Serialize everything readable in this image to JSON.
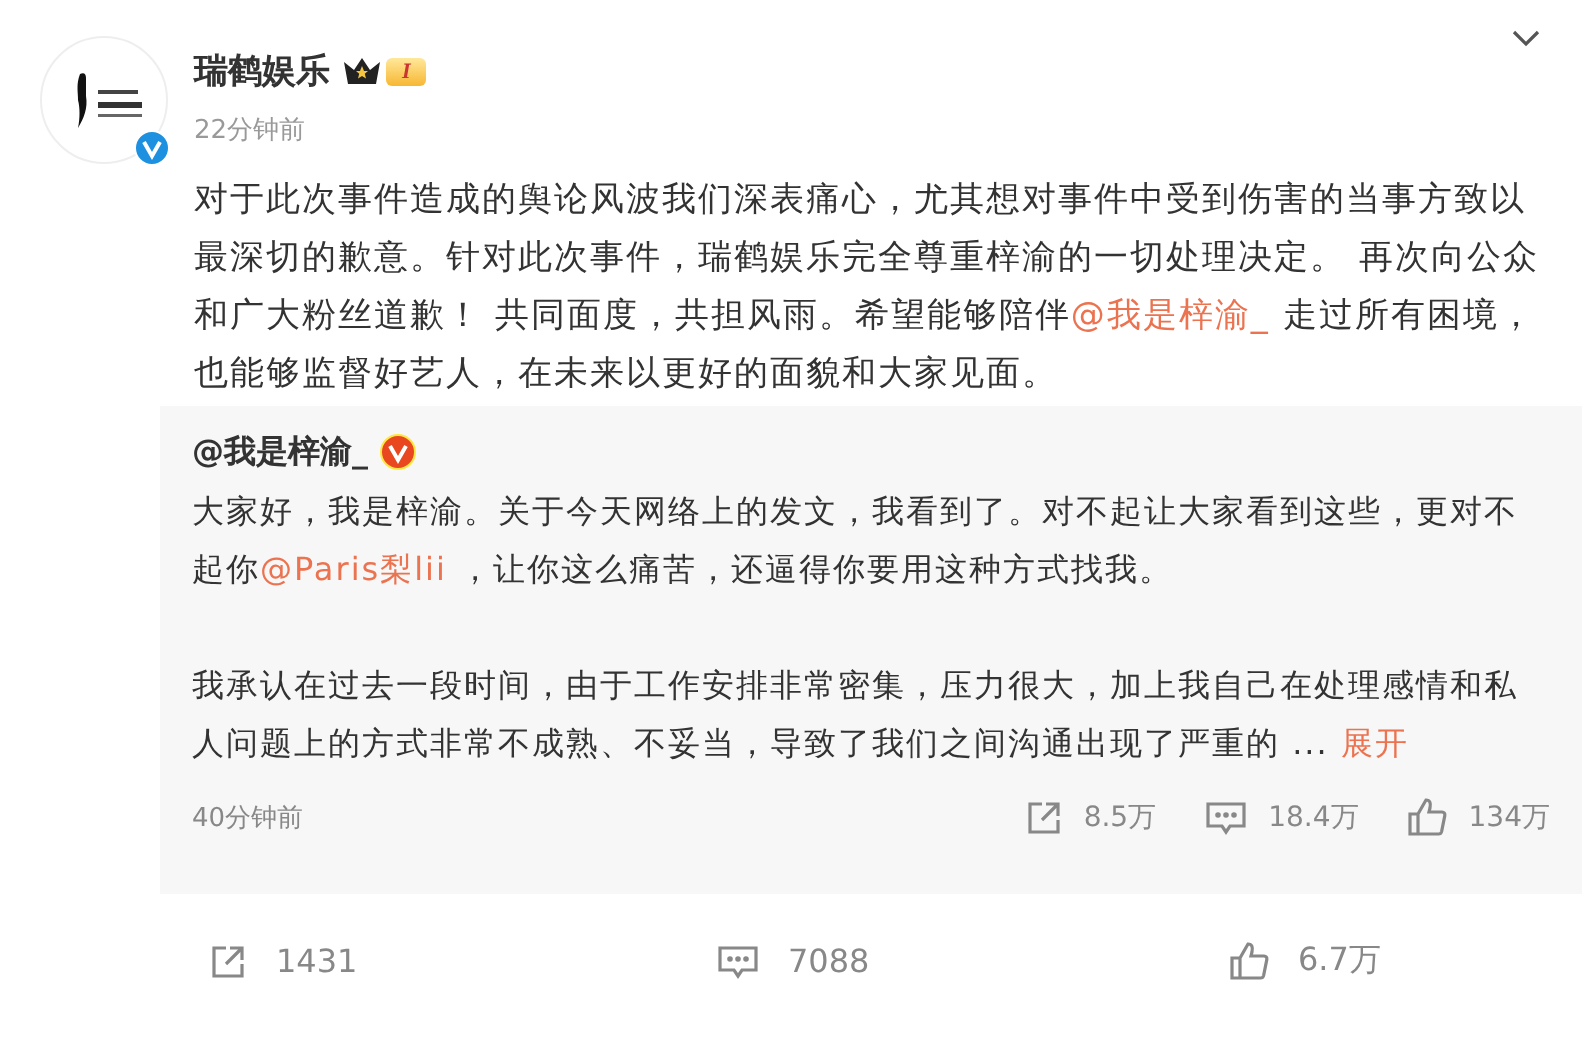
{
  "post": {
    "author": "瑞鹤娱乐",
    "level_badge": "I",
    "verified": true,
    "time": "22分钟前",
    "body": [
      {
        "kind": "text",
        "text": "对于此次事件造成的舆论风波我们深表痛心，尤其想对事件中受到伤害的当事方致以最深切的歉意。针对此次事件，瑞鹤娱乐完全尊重梓渝的一切处理决定。 再次向公众和广大粉丝道歉！ 共同面度，共担风雨。希望能够陪伴"
      },
      {
        "kind": "mention",
        "text": "@我是梓渝_"
      },
      {
        "kind": "text",
        "text": " 走过所有困境，也能够监督好艺人，在未来以更好的面貌和大家见面。"
      }
    ]
  },
  "repost": {
    "author": "@我是梓渝_",
    "verified": true,
    "paragraphs": [
      [
        {
          "kind": "text",
          "text": "大家好，我是梓渝。关于今天网络上的发文，我看到了。对不起让大家看到这些，更对不起你"
        },
        {
          "kind": "mention",
          "text": "@Paris梨lii"
        },
        {
          "kind": "text",
          "text": " ，让你这么痛苦，还逼得你要用这种方式找我。"
        }
      ],
      [
        {
          "kind": "text",
          "text": "我承认在过去一段时间，由于工作安排非常密集，压力很大，加上我自己在处理感情和私人问题上的方式非常不成熟、不妥当，导致了我们之间沟通出现了严重的 ... "
        },
        {
          "kind": "expand",
          "text": "展开"
        }
      ]
    ],
    "time": "40分钟前",
    "stats": [
      {
        "kind": "repost",
        "text": "8.5万"
      },
      {
        "kind": "comment",
        "text": "18.4万"
      },
      {
        "kind": "like",
        "text": "134万"
      }
    ]
  },
  "actions": [
    {
      "kind": "repost",
      "text": "1431"
    },
    {
      "kind": "comment",
      "text": "7088"
    },
    {
      "kind": "like",
      "text": "6.7万"
    }
  ]
}
